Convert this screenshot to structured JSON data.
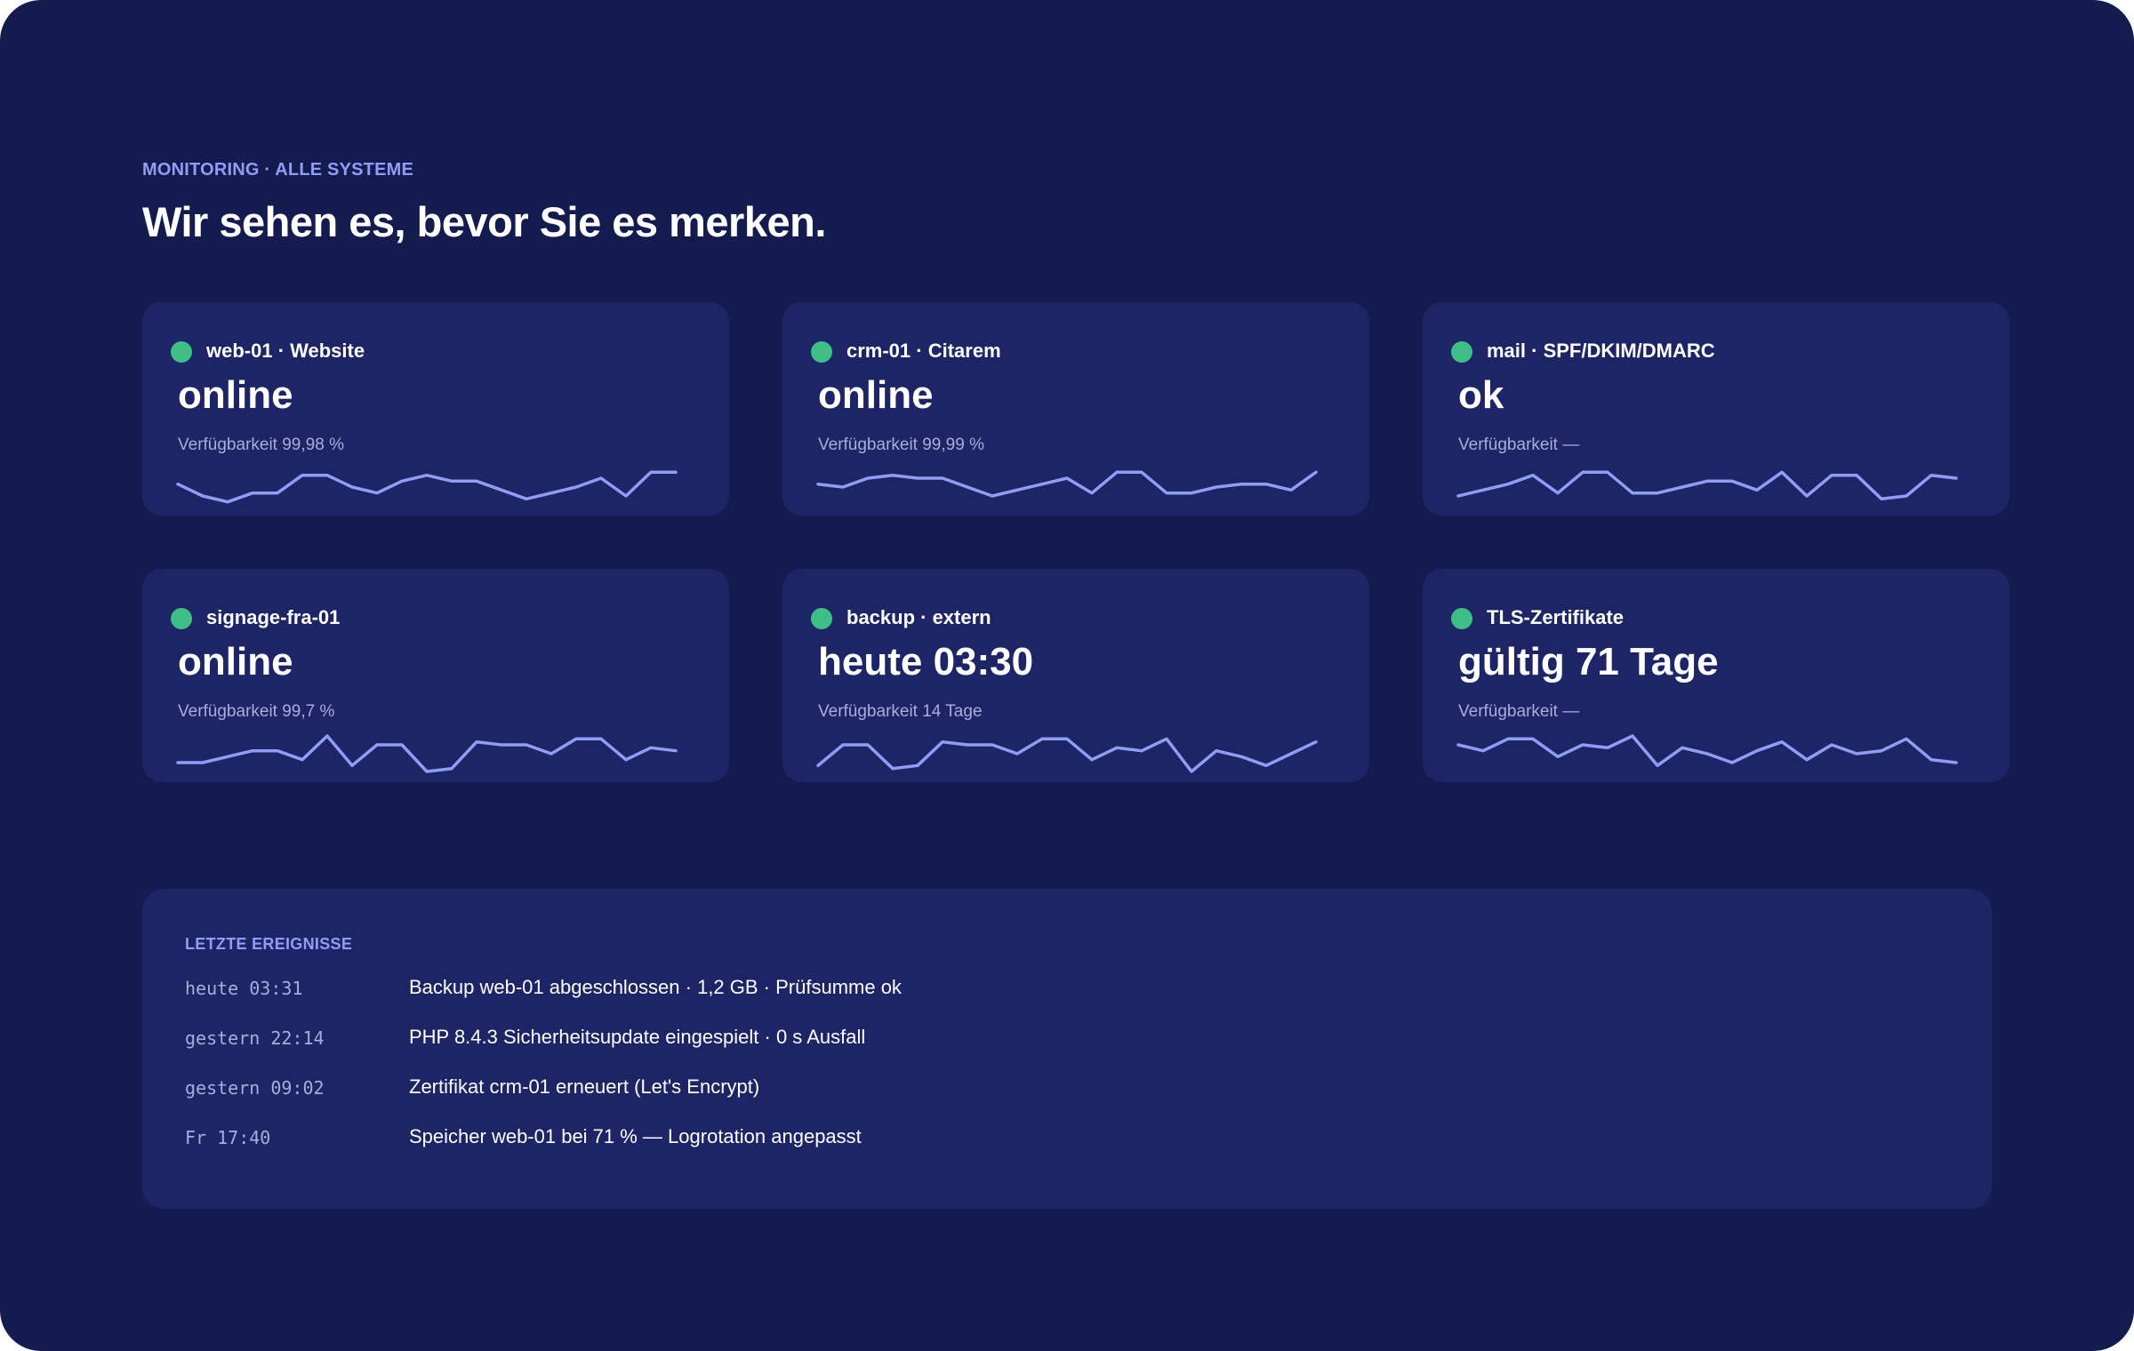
{
  "section": {
    "eyebrow": "MONITORING · ALLE SYSTEME",
    "headline": "Wir sehen es, bevor Sie es merken."
  },
  "colors": {
    "background": "#141c4f",
    "card": "#1d2566",
    "accent": "#8f9df5",
    "status_ok": "#3fbf85"
  },
  "cards": [
    {
      "name": "web-01 · Website",
      "status": "online",
      "availability": "Verfügbarkeit 99,98 %",
      "indicator": "green",
      "spark": [
        7,
        3,
        1,
        4,
        4,
        10,
        10,
        6,
        4,
        8,
        10,
        8,
        8,
        5,
        2,
        4,
        6,
        9,
        3,
        11,
        11
      ]
    },
    {
      "name": "crm-01 · Citarem",
      "status": "online",
      "availability": "Verfügbarkeit 99,99 %",
      "indicator": "green",
      "spark": [
        7,
        6,
        9,
        10,
        9,
        9,
        6,
        3,
        5,
        7,
        9,
        4,
        11,
        11,
        4,
        4,
        6,
        7,
        7,
        5,
        11
      ]
    },
    {
      "name": "mail · SPF/DKIM/DMARC",
      "status": "ok",
      "availability": "Verfügbarkeit —",
      "indicator": "green",
      "spark": [
        3,
        5,
        7,
        10,
        4,
        11,
        11,
        4,
        4,
        6,
        8,
        8,
        5,
        11,
        3,
        10,
        10,
        2,
        3,
        10,
        9
      ]
    },
    {
      "name": "signage-fra-01",
      "status": "online",
      "availability": "Verfügbarkeit 99,7 %",
      "indicator": "green",
      "spark": [
        3,
        3,
        5,
        7,
        7,
        4,
        12,
        2,
        9,
        9,
        0,
        1,
        10,
        9,
        9,
        6,
        11,
        11,
        4,
        8,
        7
      ]
    },
    {
      "name": "backup · extern",
      "status": "heute 03:30",
      "availability": "Verfügbarkeit 14 Tage",
      "indicator": "green",
      "spark": [
        2,
        9,
        9,
        1,
        2,
        10,
        9,
        9,
        6,
        11,
        11,
        4,
        8,
        7,
        11,
        0,
        7,
        5,
        2,
        6,
        10
      ]
    },
    {
      "name": "TLS-Zertifikate",
      "status": "gültig 71 Tage",
      "availability": "Verfügbarkeit —",
      "indicator": "green",
      "spark": [
        9,
        7,
        11,
        11,
        5,
        9,
        8,
        12,
        2,
        8,
        6,
        3,
        7,
        10,
        4,
        9,
        6,
        7,
        11,
        4,
        3
      ]
    }
  ],
  "events": {
    "title": "LETZTE EREIGNISSE",
    "items": [
      {
        "time": "heute 03:31",
        "message": "Backup web-01 abgeschlossen · 1,2 GB · Prüfsumme ok"
      },
      {
        "time": "gestern 22:14",
        "message": "PHP 8.4.3 Sicherheitsupdate eingespielt · 0 s Ausfall"
      },
      {
        "time": "gestern 09:02",
        "message": "Zertifikat crm-01 erneuert (Let's Encrypt)"
      },
      {
        "time": "Fr 17:40",
        "message": "Speicher web-01 bei 71 % — Logrotation angepasst"
      }
    ]
  }
}
